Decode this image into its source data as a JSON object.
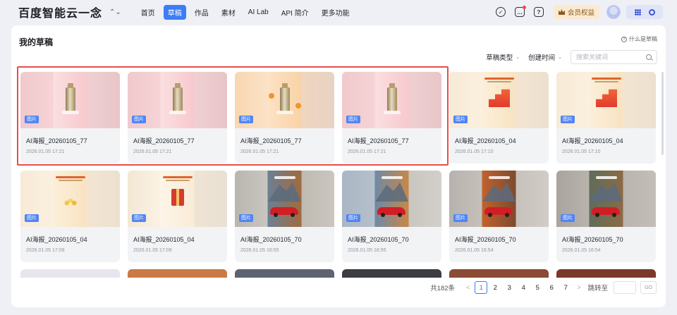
{
  "topbar": {
    "logo": "百度智能云一念",
    "switch_icon": "⌃⌄",
    "nav": [
      {
        "label": "首页",
        "active": false
      },
      {
        "label": "草稿",
        "active": true
      },
      {
        "label": "作品",
        "active": false
      },
      {
        "label": "素材",
        "active": false
      },
      {
        "label": "AI Lab",
        "active": false
      },
      {
        "label": "API 简介",
        "active": false
      },
      {
        "label": "更多功能",
        "active": false
      }
    ],
    "icons": [
      "check-icon",
      "message-icon",
      "help-icon"
    ],
    "vip_label": "会员权益"
  },
  "panel": {
    "title": "我的草稿",
    "help_label": "什么是草稿",
    "filters": {
      "type_label": "草稿类型",
      "time_label": "创建时间",
      "search_placeholder": "搜索关键词"
    }
  },
  "drafts": [
    {
      "name": "AI海报_20260105_77",
      "date": "2026.01.05 17:21",
      "tag": "图片",
      "thumb": "t-pink",
      "art": "bottle"
    },
    {
      "name": "AI海报_20260105_77",
      "date": "2026.01.05 17:21",
      "tag": "图片",
      "thumb": "t-pink",
      "art": "bottle"
    },
    {
      "name": "AI海报_20260105_77",
      "date": "2026.01.05 17:21",
      "tag": "图片",
      "thumb": "t-peach",
      "art": "bottle-orange"
    },
    {
      "name": "AI海报_20260105_77",
      "date": "2026.01.05 17:21",
      "tag": "图片",
      "thumb": "t-pink",
      "art": "bottle"
    },
    {
      "name": "AI海报_20260105_04",
      "date": "2026.01.05 17:10",
      "tag": "图片",
      "thumb": "t-cream",
      "art": "poster"
    },
    {
      "name": "AI海报_20260105_04",
      "date": "2026.01.05 17:10",
      "tag": "图片",
      "thumb": "t-cream",
      "art": "poster"
    },
    {
      "name": "AI海报_20260105_04",
      "date": "2026.01.05 17:09",
      "tag": "图片",
      "thumb": "t-cream",
      "art": "coins"
    },
    {
      "name": "AI海报_20260105_04",
      "date": "2026.01.05 17:09",
      "tag": "图片",
      "thumb": "t-cream2",
      "art": "gift"
    },
    {
      "name": "AI海报_20260105_70",
      "date": "2026.01.05 16:55",
      "tag": "图片",
      "thumb": "t-mtn",
      "art": "car"
    },
    {
      "name": "AI海报_20260105_70",
      "date": "2026.01.05 16:55",
      "tag": "图片",
      "thumb": "t-mtn2",
      "art": "car"
    },
    {
      "name": "AI海报_20260105_70",
      "date": "2026.01.05 16:54",
      "tag": "图片",
      "thumb": "t-mtn3",
      "art": "car"
    },
    {
      "name": "AI海报_20260105_70",
      "date": "2026.01.05 16:54",
      "tag": "图片",
      "thumb": "t-mtn4",
      "art": "car"
    }
  ],
  "partial_row_colors": [
    "#e9e5ef",
    "#c97a45",
    "#5d6470",
    "#3b3d42",
    "#8a4a33",
    "#7a3a2a"
  ],
  "pagination": {
    "total": "共182条",
    "prev": "<",
    "next": ">",
    "pages": [
      "1",
      "2",
      "3",
      "4",
      "5",
      "6",
      "7"
    ],
    "current": "1",
    "jump_label": "跳转至",
    "go_label": "GO"
  },
  "colors": {
    "accent": "#3d7cf5",
    "highlight": "#e94d4a",
    "tag": "#4f85f6"
  }
}
